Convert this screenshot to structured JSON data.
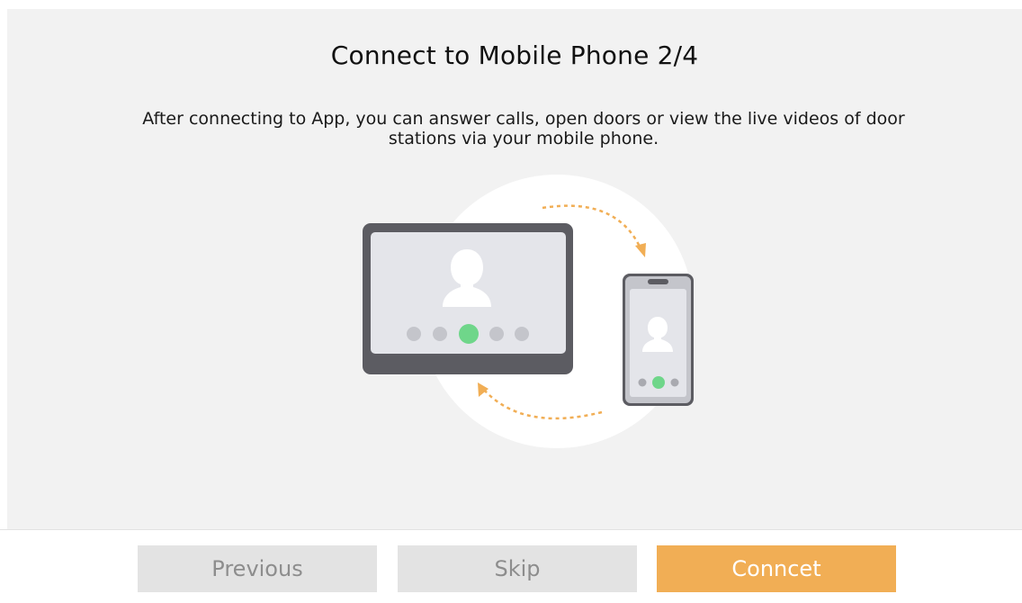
{
  "header": {
    "title": "Connect to Mobile Phone 2/4",
    "description": "After connecting to App, you can answer calls, open doors or view the live videos of door stations via your mobile phone."
  },
  "illustration": {
    "icons": [
      "indoor-station-icon",
      "mobile-phone-icon",
      "sync-arrow-icon"
    ],
    "accent_color": "#f1ae55",
    "call_color": "#6fd68a"
  },
  "footer": {
    "previous_label": "Previous",
    "skip_label": "Skip",
    "connect_label": "Conncet"
  },
  "colors": {
    "primary": "#f1ae55",
    "disabled_bg": "#e3e3e3",
    "disabled_text": "#8d8d8d"
  }
}
